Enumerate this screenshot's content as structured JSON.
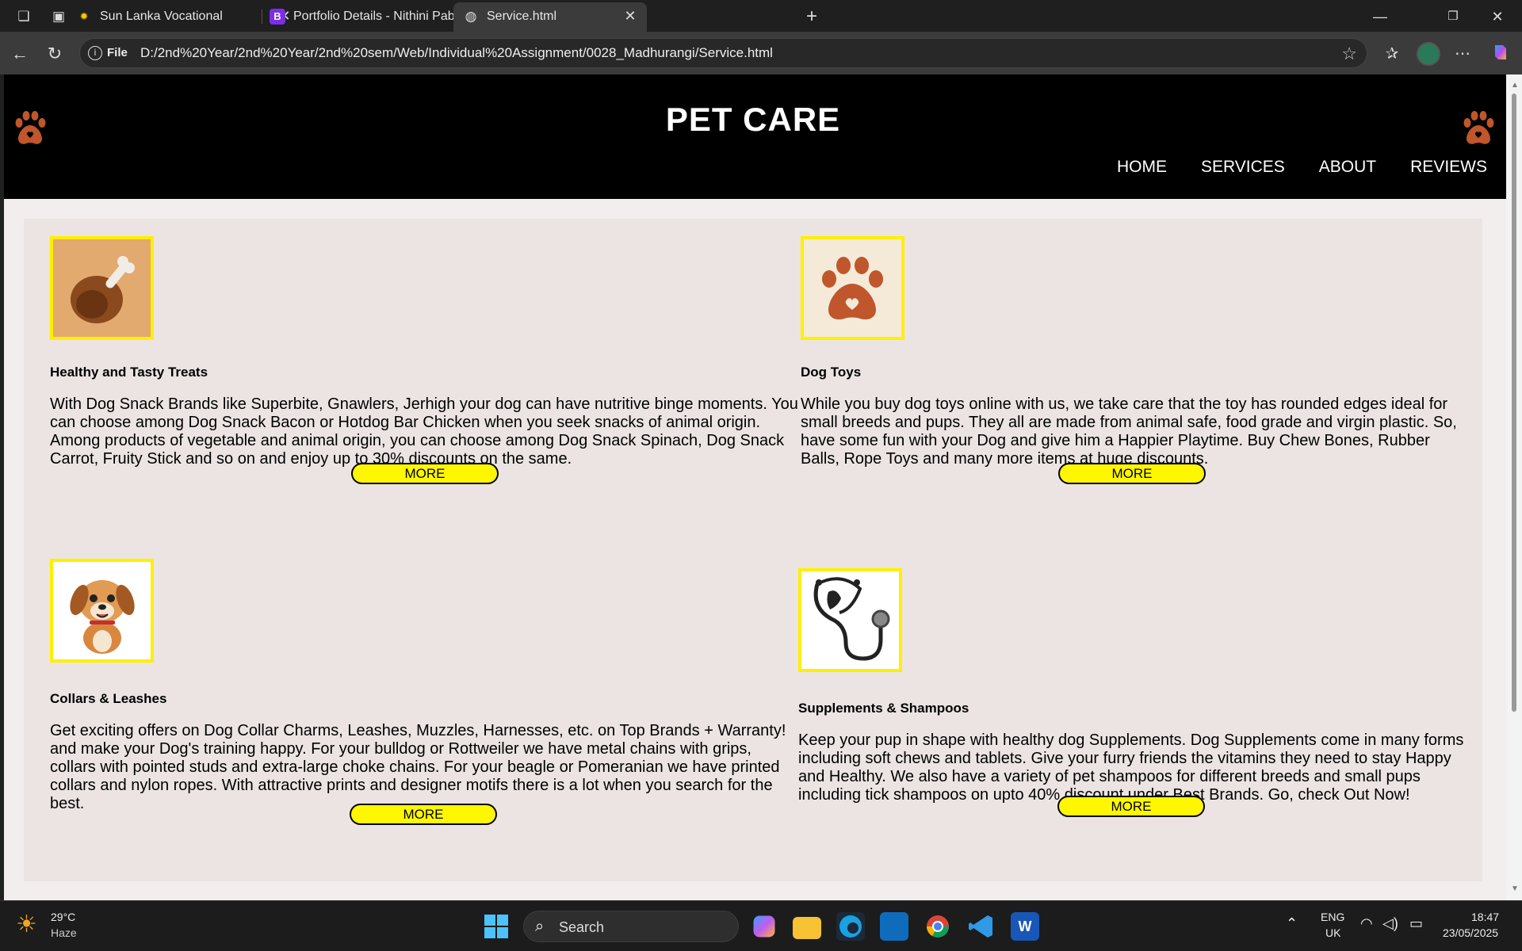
{
  "browser": {
    "tabs": [
      {
        "title": "Sun Lanka Vocational",
        "favicon": "sun-icon"
      },
      {
        "title": "Portfolio Details - Nithini Pabasara",
        "favicon": "bootstrap-icon"
      },
      {
        "title": "Service.html",
        "favicon": "globe-icon"
      }
    ],
    "address_bar": {
      "scheme_label": "File",
      "url": "D:/2nd%20Year/2nd%20Year/2nd%20sem/Web/Individual%20Assignment/0028_Madhurangi/Service.html"
    }
  },
  "page": {
    "title": "PET CARE",
    "nav": [
      "HOME",
      "SERVICES",
      "ABOUT",
      "REVIEWS"
    ],
    "services": [
      {
        "icon": "chicken-leg-icon",
        "heading": "Healthy and Tasty Treats",
        "text": "With Dog Snack Brands like Superbite, Gnawlers, Jerhigh your dog can have nutritive binge moments. You can choose among Dog Snack Bacon or Hotdog Bar Chicken when you seek snacks of animal origin. Among products of vegetable and animal origin, you can choose among Dog Snack Spinach, Dog Snack Carrot, Fruity Stick and so on and enjoy up to 30% discounts on the same.",
        "button": "MORE"
      },
      {
        "icon": "paw-heart-icon",
        "heading": "Dog Toys",
        "text": "While you buy dog toys online with us, we take care that the toy has rounded edges ideal for small breeds and pups. They all are made from animal safe, food grade and virgin plastic. So, have some fun with your Dog and give him a Happier Playtime. Buy Chew Bones, Rubber Balls, Rope Toys and many more items at huge discounts.",
        "button": "MORE"
      },
      {
        "icon": "puppy-icon",
        "heading": "Collars & Leashes",
        "text": "Get exciting offers on Dog Collar Charms, Leashes, Muzzles, Harnesses, etc. on Top Brands + Warranty! and make your Dog's training happy. For your bulldog or Rottweiler we have metal chains with grips, collars with pointed studs and extra-large choke chains. For your beagle or Pomeranian we have printed collars and nylon ropes. With attractive prints and designer motifs there is a lot when you search for the best.",
        "button": "MORE"
      },
      {
        "icon": "stethoscope-icon",
        "heading": "Supplements & Shampoos",
        "text": "Keep your pup in shape with healthy dog Supplements. Dog Supplements come in many forms including soft chews and tablets. Give your furry friends the vitamins they need to stay Happy and Healthy. We also have a variety of pet shampoos for different breeds and small pups including tick shampoos on upto 40% discount under Best Brands. Go, check Out Now!",
        "button": "MORE"
      }
    ]
  },
  "taskbar": {
    "weather_temp": "29°C",
    "weather_desc": "Haze",
    "search_placeholder": "Search",
    "lang_line1": "ENG",
    "lang_line2": "UK",
    "time": "18:47",
    "date": "23/05/2025"
  },
  "colors": {
    "accent_button": "#fff700",
    "image_border": "#ffef00",
    "header_bg": "#000000",
    "paw_color": "#c0562b"
  }
}
